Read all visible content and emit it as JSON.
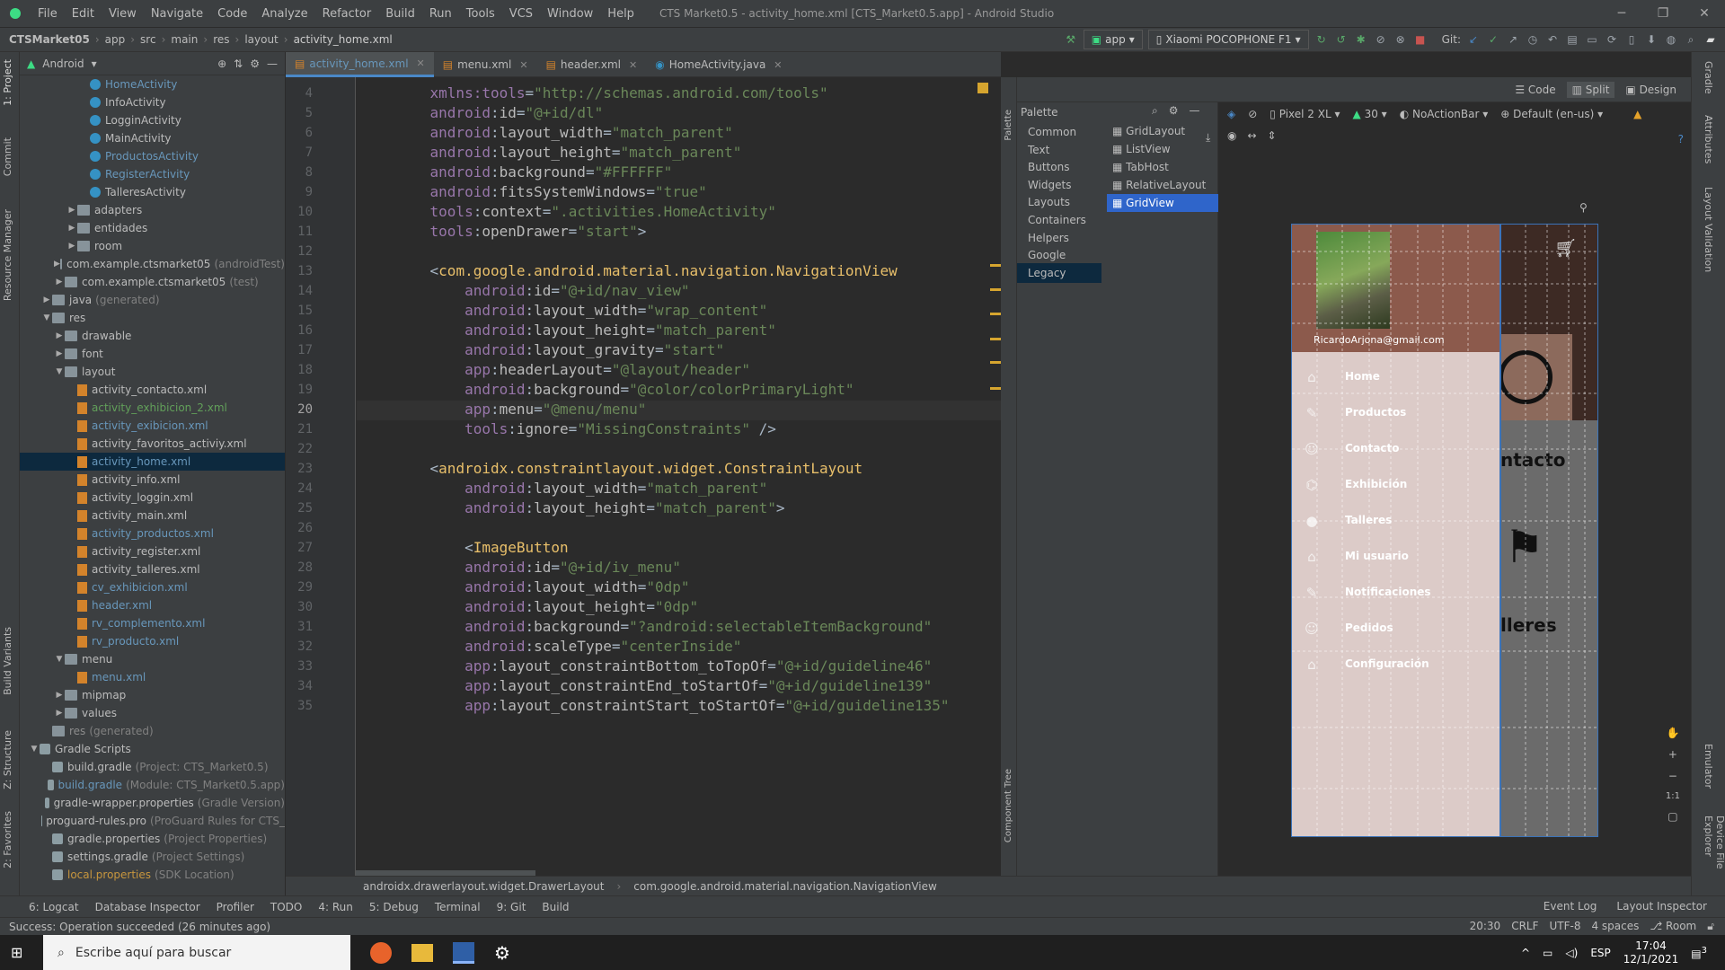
{
  "window": {
    "menu": [
      "File",
      "Edit",
      "View",
      "Navigate",
      "Code",
      "Analyze",
      "Refactor",
      "Build",
      "Run",
      "Tools",
      "VCS",
      "Window",
      "Help"
    ],
    "title": "CTS Market0.5 - activity_home.xml [CTS_Market0.5.app] - Android Studio"
  },
  "nav": {
    "breadcrumb": [
      "CTSMarket05",
      "app",
      "src",
      "main",
      "res",
      "layout",
      "activity_home.xml"
    ],
    "run_config": "app",
    "device": "Xiaomi POCOPHONE F1",
    "git_label": "Git:"
  },
  "project": {
    "view": "Android",
    "tree": [
      {
        "indent": 3,
        "icon": "cls",
        "label": "HomeActivity",
        "cls": "blue"
      },
      {
        "indent": 3,
        "icon": "cls",
        "label": "InfoActivity"
      },
      {
        "indent": 3,
        "icon": "cls",
        "label": "LogginActivity"
      },
      {
        "indent": 3,
        "icon": "cls",
        "label": "MainActivity"
      },
      {
        "indent": 3,
        "icon": "cls",
        "label": "ProductosActivity",
        "cls": "blue"
      },
      {
        "indent": 3,
        "icon": "cls",
        "label": "RegisterActivity",
        "cls": "blue"
      },
      {
        "indent": 3,
        "icon": "cls",
        "label": "TalleresActivity"
      },
      {
        "indent": 2,
        "arrow": "▶",
        "icon": "folder",
        "label": "adapters"
      },
      {
        "indent": 2,
        "arrow": "▶",
        "icon": "folder",
        "label": "entidades"
      },
      {
        "indent": 2,
        "arrow": "▶",
        "icon": "folder",
        "label": "room"
      },
      {
        "indent": 1,
        "arrow": "▶",
        "icon": "folder",
        "label": "com.example.ctsmarket05",
        "suffix": "(androidTest)"
      },
      {
        "indent": 1,
        "arrow": "▶",
        "icon": "folder",
        "label": "com.example.ctsmarket05",
        "suffix": "(test)"
      },
      {
        "indent": 0,
        "arrow": "▶",
        "icon": "folder",
        "label": "java",
        "suffix": "(generated)"
      },
      {
        "indent": 0,
        "arrow": "▼",
        "icon": "folder",
        "label": "res"
      },
      {
        "indent": 1,
        "arrow": "▶",
        "icon": "folder",
        "label": "drawable"
      },
      {
        "indent": 1,
        "arrow": "▶",
        "icon": "folder",
        "label": "font"
      },
      {
        "indent": 1,
        "arrow": "▼",
        "icon": "folder",
        "label": "layout"
      },
      {
        "indent": 2,
        "icon": "xml",
        "label": "activity_contacto.xml"
      },
      {
        "indent": 2,
        "icon": "xml",
        "label": "activity_exhibicion_2.xml",
        "cls": "green"
      },
      {
        "indent": 2,
        "icon": "xml",
        "label": "activity_exibicion.xml",
        "cls": "blue"
      },
      {
        "indent": 2,
        "icon": "xml",
        "label": "activity_favoritos_activiy.xml"
      },
      {
        "indent": 2,
        "icon": "xml",
        "label": "activity_home.xml",
        "cls": "blue",
        "sel": true
      },
      {
        "indent": 2,
        "icon": "xml",
        "label": "activity_info.xml"
      },
      {
        "indent": 2,
        "icon": "xml",
        "label": "activity_loggin.xml"
      },
      {
        "indent": 2,
        "icon": "xml",
        "label": "activity_main.xml"
      },
      {
        "indent": 2,
        "icon": "xml",
        "label": "activity_productos.xml",
        "cls": "blue"
      },
      {
        "indent": 2,
        "icon": "xml",
        "label": "activity_register.xml"
      },
      {
        "indent": 2,
        "icon": "xml",
        "label": "activity_talleres.xml"
      },
      {
        "indent": 2,
        "icon": "xml",
        "label": "cv_exhibicion.xml",
        "cls": "blue"
      },
      {
        "indent": 2,
        "icon": "xml",
        "label": "header.xml",
        "cls": "blue"
      },
      {
        "indent": 2,
        "icon": "xml",
        "label": "rv_complemento.xml",
        "cls": "blue"
      },
      {
        "indent": 2,
        "icon": "xml",
        "label": "rv_producto.xml",
        "cls": "blue"
      },
      {
        "indent": 1,
        "arrow": "▼",
        "icon": "folder",
        "label": "menu"
      },
      {
        "indent": 2,
        "icon": "xml",
        "label": "menu.xml",
        "cls": "blue"
      },
      {
        "indent": 1,
        "arrow": "▶",
        "icon": "folder",
        "label": "mipmap"
      },
      {
        "indent": 1,
        "arrow": "▶",
        "icon": "folder",
        "label": "values"
      },
      {
        "indent": 0,
        "icon": "folder",
        "label": "res",
        "suffix": "(generated)",
        "cls": "grey"
      },
      {
        "indent": -1,
        "arrow": "▼",
        "icon": "grad",
        "label": "Gradle Scripts"
      },
      {
        "indent": 0,
        "icon": "grad",
        "label": "build.gradle",
        "suffix": "(Project: CTS_Market0.5)"
      },
      {
        "indent": 0,
        "icon": "grad",
        "label": "build.gradle",
        "suffix": "(Module: CTS_Market0.5.app)",
        "cls": "blue"
      },
      {
        "indent": 0,
        "icon": "grad",
        "label": "gradle-wrapper.properties",
        "suffix": "(Gradle Version)"
      },
      {
        "indent": 0,
        "icon": "grad",
        "label": "proguard-rules.pro",
        "suffix": "(ProGuard Rules for CTS_"
      },
      {
        "indent": 0,
        "icon": "grad",
        "label": "gradle.properties",
        "suffix": "(Project Properties)"
      },
      {
        "indent": 0,
        "icon": "grad",
        "label": "settings.gradle",
        "suffix": "(Project Settings)"
      },
      {
        "indent": 0,
        "icon": "grad",
        "label": "local.properties",
        "suffix": "(SDK Location)",
        "cls": "orange"
      }
    ]
  },
  "tabs": [
    {
      "label": "activity_home.xml",
      "active": true
    },
    {
      "label": "menu.xml"
    },
    {
      "label": "header.xml"
    },
    {
      "label": "HomeActivity.java"
    }
  ],
  "code": [
    {
      "n": "4",
      "html": "    <span class=\"ns\">xmlns:tools</span>=<span class=\"val\">\"http://schemas.android.com/tools\"</span>"
    },
    {
      "n": "5",
      "html": "    <span class=\"ns\">android</span>:<span class=\"att\">id</span>=<span class=\"val\">\"@+id/dl\"</span>"
    },
    {
      "n": "6",
      "html": "    <span class=\"ns\">android</span>:<span class=\"att\">layout_width</span>=<span class=\"val\">\"match_parent\"</span>"
    },
    {
      "n": "7",
      "html": "    <span class=\"ns\">android</span>:<span class=\"att\">layout_height</span>=<span class=\"val\">\"match_parent\"</span>"
    },
    {
      "n": "8",
      "html": "    <span class=\"ns\">android</span>:<span class=\"att\">background</span>=<span class=\"val\">\"#FFFFFF\"</span>"
    },
    {
      "n": "9",
      "html": "    <span class=\"ns\">android</span>:<span class=\"att\">fitsSystemWindows</span>=<span class=\"val\">\"true\"</span>"
    },
    {
      "n": "10",
      "html": "    <span class=\"ns\">tools</span>:<span class=\"att\">context</span>=<span class=\"val\">\".activities.HomeActivity\"</span>"
    },
    {
      "n": "11",
      "html": "    <span class=\"ns\">tools</span>:<span class=\"att\">openDrawer</span>=<span class=\"val\">\"start\"</span>&gt;"
    },
    {
      "n": "12",
      "html": ""
    },
    {
      "n": "13",
      "html": "    &lt;<span class=\"tag\">com.google.android.material.navigation.NavigationView</span>"
    },
    {
      "n": "14",
      "html": "        <span class=\"ns\">android</span>:<span class=\"att\">id</span>=<span class=\"val\">\"@+id/nav_view\"</span>"
    },
    {
      "n": "15",
      "html": "        <span class=\"ns\">android</span>:<span class=\"att\">layout_width</span>=<span class=\"val\">\"wrap_content\"</span>"
    },
    {
      "n": "16",
      "html": "        <span class=\"ns\">android</span>:<span class=\"att\">layout_height</span>=<span class=\"val\">\"match_parent\"</span>"
    },
    {
      "n": "17",
      "html": "        <span class=\"ns\">android</span>:<span class=\"att\">layout_gravity</span>=<span class=\"val\">\"start\"</span>"
    },
    {
      "n": "18",
      "html": "        <span class=\"ns\">app</span>:<span class=\"att\">headerLayout</span>=<span class=\"val\">\"@layout/header\"</span>"
    },
    {
      "n": "19",
      "html": "        <span class=\"ns\">android</span>:<span class=\"att\">background</span>=<span class=\"val\">\"@color/colorPrimaryLight\"</span>"
    },
    {
      "n": "20",
      "html": "        <span class=\"ns\">app</span>:<span class=\"att\">menu</span>=<span class=\"val\">\"@menu/menu\"</span>",
      "cur": true
    },
    {
      "n": "21",
      "html": "        <span class=\"ns\">tools</span>:<span class=\"att\">ignore</span>=<span class=\"val\">\"MissingConstraints\"</span> /&gt;"
    },
    {
      "n": "22",
      "html": ""
    },
    {
      "n": "23",
      "html": "    &lt;<span class=\"tag\">androidx.constraintlayout.widget.ConstraintLayout</span>"
    },
    {
      "n": "24",
      "html": "        <span class=\"ns\">android</span>:<span class=\"att\">layout_width</span>=<span class=\"val\">\"match_parent\"</span>"
    },
    {
      "n": "25",
      "html": "        <span class=\"ns\">android</span>:<span class=\"att\">layout_height</span>=<span class=\"val\">\"match_parent\"</span>&gt;"
    },
    {
      "n": "26",
      "html": ""
    },
    {
      "n": "27",
      "html": "        &lt;<span class=\"tag\">ImageButton</span>"
    },
    {
      "n": "28",
      "html": "        <span class=\"ns\">android</span>:<span class=\"att\">id</span>=<span class=\"val\">\"@+id/iv_menu\"</span>"
    },
    {
      "n": "29",
      "html": "        <span class=\"ns\">android</span>:<span class=\"att\">layout_width</span>=<span class=\"val\">\"0dp\"</span>"
    },
    {
      "n": "30",
      "html": "        <span class=\"ns\">android</span>:<span class=\"att\">layout_height</span>=<span class=\"val\">\"0dp\"</span>"
    },
    {
      "n": "31",
      "html": "        <span class=\"ns\">android</span>:<span class=\"att\">background</span>=<span class=\"val\">\"?android:selectableItemBackground\"</span>"
    },
    {
      "n": "32",
      "html": "        <span class=\"ns\">android</span>:<span class=\"att\">scaleType</span>=<span class=\"val\">\"centerInside\"</span>"
    },
    {
      "n": "33",
      "html": "        <span class=\"ns\">app</span>:<span class=\"att\">layout_constraintBottom_toTopOf</span>=<span class=\"val\">\"@+id/guideline46\"</span>"
    },
    {
      "n": "34",
      "html": "        <span class=\"ns\">app</span>:<span class=\"att\">layout_constraintEnd_toStartOf</span>=<span class=\"val\">\"@+id/guideline139\"</span>"
    },
    {
      "n": "35",
      "html": "        <span class=\"ns\">app</span>:<span class=\"att\">layout_constraintStart_toStartOf</span>=<span class=\"val\">\"@+id/guideline135\"</span>"
    }
  ],
  "design": {
    "modes": [
      "Code",
      "Split",
      "Design"
    ],
    "device": "Pixel 2 XL",
    "api": "30",
    "theme": "NoActionBar",
    "locale": "Default (en-us)",
    "palette_title": "Palette",
    "categories": [
      "Common",
      "Text",
      "Buttons",
      "Widgets",
      "Layouts",
      "Containers",
      "Helpers",
      "Google",
      "Legacy"
    ],
    "items": [
      "GridLayout",
      "ListView",
      "TabHost",
      "RelativeLayout",
      "GridView"
    ],
    "component_tree": "Component Tree"
  },
  "preview": {
    "email": "RicardoArjona@gmail.com",
    "menu": [
      {
        "icon": "⌂",
        "label": "Home"
      },
      {
        "icon": "✎",
        "label": "Productos"
      },
      {
        "icon": "☺",
        "label": "Contacto"
      },
      {
        "icon": "⌬",
        "label": "Exhibición"
      },
      {
        "icon": "●",
        "label": "Talleres"
      },
      {
        "icon": "⌂",
        "label": "Mi usuario"
      },
      {
        "icon": "✎",
        "label": "Notificaciones"
      },
      {
        "icon": "☺",
        "label": "Pedidos"
      },
      {
        "icon": "⌂",
        "label": "Configuración"
      }
    ],
    "bg_text1": "ntacto",
    "bg_text2": "lleres"
  },
  "bottom": {
    "crumbs": [
      "androidx.drawerlayout.widget.DrawerLayout",
      "com.google.android.material.navigation.NavigationView"
    ],
    "tools": [
      "6: Logcat",
      "Database Inspector",
      "Profiler",
      "TODO",
      "4: Run",
      "5: Debug",
      "Terminal",
      "9: Git",
      "Build"
    ],
    "right_tools": [
      "Event Log",
      "Layout Inspector"
    ],
    "status": "Success: Operation succeeded (26 minutes ago)",
    "position": "20:30",
    "line_sep": "CRLF",
    "encoding": "UTF-8",
    "indent": "4 spaces",
    "room": "Room"
  },
  "taskbar": {
    "search_placeholder": "Escribe aquí para buscar",
    "lang": "ESP",
    "time": "17:04",
    "date": "12/1/2021",
    "notif": "3"
  },
  "stripes": {
    "left": [
      "1: Project",
      "Commit",
      "Resource Manager",
      "Build Variants",
      "Z: Structure",
      "2: Favorites"
    ],
    "right": [
      "Gradle",
      "Attributes",
      "Layout Validation",
      "Emulator",
      "Device File Explorer"
    ]
  }
}
